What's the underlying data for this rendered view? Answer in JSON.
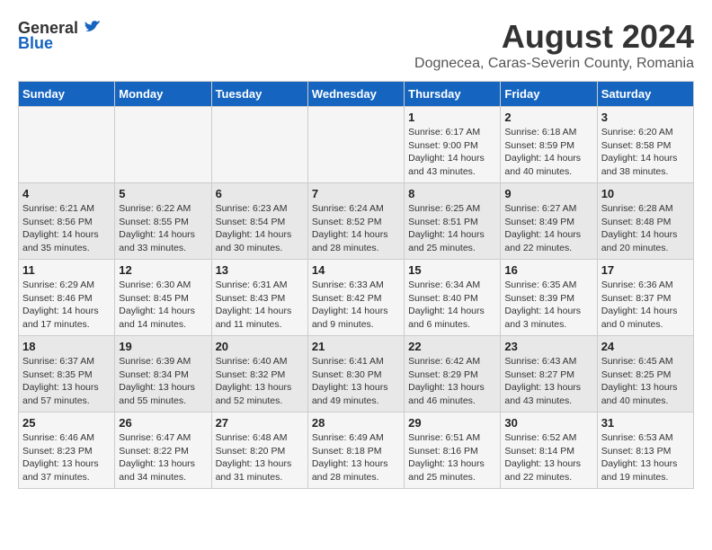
{
  "header": {
    "logo_general": "General",
    "logo_blue": "Blue",
    "month_title": "August 2024",
    "location": "Dognecea, Caras-Severin County, Romania"
  },
  "weekdays": [
    "Sunday",
    "Monday",
    "Tuesday",
    "Wednesday",
    "Thursday",
    "Friday",
    "Saturday"
  ],
  "weeks": [
    [
      {
        "day": "",
        "info": ""
      },
      {
        "day": "",
        "info": ""
      },
      {
        "day": "",
        "info": ""
      },
      {
        "day": "",
        "info": ""
      },
      {
        "day": "1",
        "info": "Sunrise: 6:17 AM\nSunset: 9:00 PM\nDaylight: 14 hours\nand 43 minutes."
      },
      {
        "day": "2",
        "info": "Sunrise: 6:18 AM\nSunset: 8:59 PM\nDaylight: 14 hours\nand 40 minutes."
      },
      {
        "day": "3",
        "info": "Sunrise: 6:20 AM\nSunset: 8:58 PM\nDaylight: 14 hours\nand 38 minutes."
      }
    ],
    [
      {
        "day": "4",
        "info": "Sunrise: 6:21 AM\nSunset: 8:56 PM\nDaylight: 14 hours\nand 35 minutes."
      },
      {
        "day": "5",
        "info": "Sunrise: 6:22 AM\nSunset: 8:55 PM\nDaylight: 14 hours\nand 33 minutes."
      },
      {
        "day": "6",
        "info": "Sunrise: 6:23 AM\nSunset: 8:54 PM\nDaylight: 14 hours\nand 30 minutes."
      },
      {
        "day": "7",
        "info": "Sunrise: 6:24 AM\nSunset: 8:52 PM\nDaylight: 14 hours\nand 28 minutes."
      },
      {
        "day": "8",
        "info": "Sunrise: 6:25 AM\nSunset: 8:51 PM\nDaylight: 14 hours\nand 25 minutes."
      },
      {
        "day": "9",
        "info": "Sunrise: 6:27 AM\nSunset: 8:49 PM\nDaylight: 14 hours\nand 22 minutes."
      },
      {
        "day": "10",
        "info": "Sunrise: 6:28 AM\nSunset: 8:48 PM\nDaylight: 14 hours\nand 20 minutes."
      }
    ],
    [
      {
        "day": "11",
        "info": "Sunrise: 6:29 AM\nSunset: 8:46 PM\nDaylight: 14 hours\nand 17 minutes."
      },
      {
        "day": "12",
        "info": "Sunrise: 6:30 AM\nSunset: 8:45 PM\nDaylight: 14 hours\nand 14 minutes."
      },
      {
        "day": "13",
        "info": "Sunrise: 6:31 AM\nSunset: 8:43 PM\nDaylight: 14 hours\nand 11 minutes."
      },
      {
        "day": "14",
        "info": "Sunrise: 6:33 AM\nSunset: 8:42 PM\nDaylight: 14 hours\nand 9 minutes."
      },
      {
        "day": "15",
        "info": "Sunrise: 6:34 AM\nSunset: 8:40 PM\nDaylight: 14 hours\nand 6 minutes."
      },
      {
        "day": "16",
        "info": "Sunrise: 6:35 AM\nSunset: 8:39 PM\nDaylight: 14 hours\nand 3 minutes."
      },
      {
        "day": "17",
        "info": "Sunrise: 6:36 AM\nSunset: 8:37 PM\nDaylight: 14 hours\nand 0 minutes."
      }
    ],
    [
      {
        "day": "18",
        "info": "Sunrise: 6:37 AM\nSunset: 8:35 PM\nDaylight: 13 hours\nand 57 minutes."
      },
      {
        "day": "19",
        "info": "Sunrise: 6:39 AM\nSunset: 8:34 PM\nDaylight: 13 hours\nand 55 minutes."
      },
      {
        "day": "20",
        "info": "Sunrise: 6:40 AM\nSunset: 8:32 PM\nDaylight: 13 hours\nand 52 minutes."
      },
      {
        "day": "21",
        "info": "Sunrise: 6:41 AM\nSunset: 8:30 PM\nDaylight: 13 hours\nand 49 minutes."
      },
      {
        "day": "22",
        "info": "Sunrise: 6:42 AM\nSunset: 8:29 PM\nDaylight: 13 hours\nand 46 minutes."
      },
      {
        "day": "23",
        "info": "Sunrise: 6:43 AM\nSunset: 8:27 PM\nDaylight: 13 hours\nand 43 minutes."
      },
      {
        "day": "24",
        "info": "Sunrise: 6:45 AM\nSunset: 8:25 PM\nDaylight: 13 hours\nand 40 minutes."
      }
    ],
    [
      {
        "day": "25",
        "info": "Sunrise: 6:46 AM\nSunset: 8:23 PM\nDaylight: 13 hours\nand 37 minutes."
      },
      {
        "day": "26",
        "info": "Sunrise: 6:47 AM\nSunset: 8:22 PM\nDaylight: 13 hours\nand 34 minutes."
      },
      {
        "day": "27",
        "info": "Sunrise: 6:48 AM\nSunset: 8:20 PM\nDaylight: 13 hours\nand 31 minutes."
      },
      {
        "day": "28",
        "info": "Sunrise: 6:49 AM\nSunset: 8:18 PM\nDaylight: 13 hours\nand 28 minutes."
      },
      {
        "day": "29",
        "info": "Sunrise: 6:51 AM\nSunset: 8:16 PM\nDaylight: 13 hours\nand 25 minutes."
      },
      {
        "day": "30",
        "info": "Sunrise: 6:52 AM\nSunset: 8:14 PM\nDaylight: 13 hours\nand 22 minutes."
      },
      {
        "day": "31",
        "info": "Sunrise: 6:53 AM\nSunset: 8:13 PM\nDaylight: 13 hours\nand 19 minutes."
      }
    ]
  ]
}
